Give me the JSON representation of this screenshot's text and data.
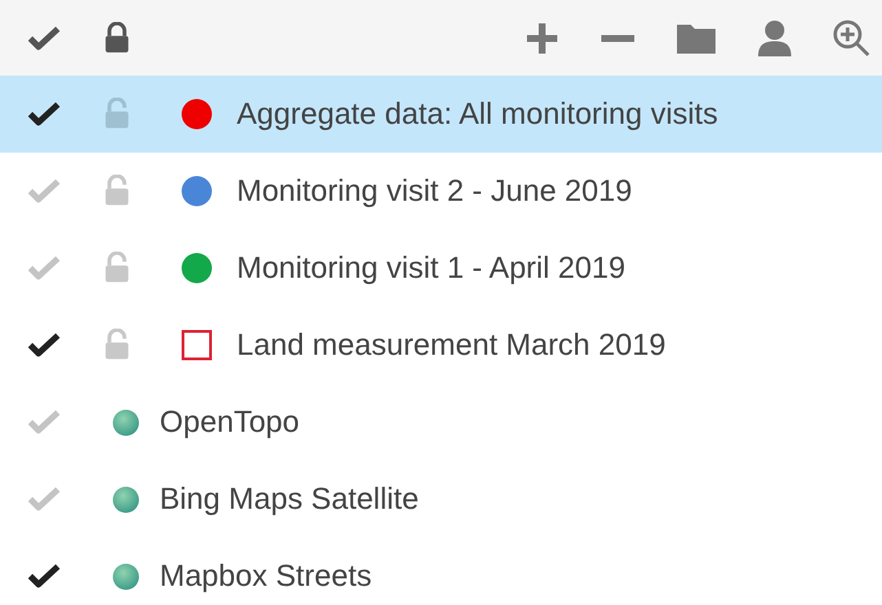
{
  "toolbar": {
    "all_visible": true,
    "all_locked": true
  },
  "layers": [
    {
      "kind": "point",
      "name": "Aggregate data: All monitoring visits",
      "visible": true,
      "locked": false,
      "selected": true,
      "color": "#ee0000"
    },
    {
      "kind": "point",
      "name": "Monitoring visit 2 - June 2019",
      "visible": false,
      "locked": false,
      "selected": false,
      "color": "#4a86d8"
    },
    {
      "kind": "point",
      "name": "Monitoring visit 1 - April 2019",
      "visible": false,
      "locked": false,
      "selected": false,
      "color": "#13a84a"
    },
    {
      "kind": "polygon",
      "name": "Land measurement March 2019",
      "visible": true,
      "locked": false,
      "selected": false,
      "color": "#dd2233"
    },
    {
      "kind": "basemap",
      "name": "OpenTopo",
      "visible": false,
      "selected": false
    },
    {
      "kind": "basemap",
      "name": "Bing Maps Satellite",
      "visible": false,
      "selected": false
    },
    {
      "kind": "basemap",
      "name": "Mapbox Streets",
      "visible": true,
      "selected": false
    }
  ]
}
